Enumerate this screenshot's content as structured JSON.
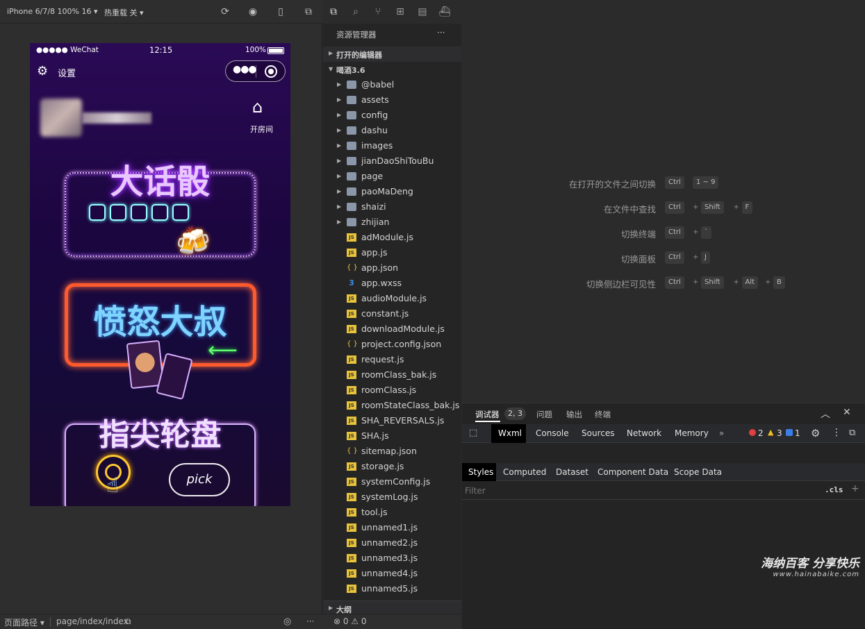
{
  "toolbar": {
    "device": "iPhone 6/7/8 100% 16",
    "hot_reload": "热重载 关"
  },
  "phone": {
    "carrier": "●●●●● WeChat",
    "time": "12:15",
    "battery": "100%",
    "settings": "设置",
    "open_room": "开房间",
    "games": [
      "大话骰",
      "愤怒大叔",
      "指尖轮盘"
    ],
    "pick": "pick"
  },
  "explorer": {
    "title": "资源管理器",
    "more": "···",
    "open_editors": "打开的编辑器",
    "project": "喝酒3.6",
    "outline": "大纲",
    "items": [
      {
        "label": "@babel",
        "type": "folder"
      },
      {
        "label": "assets",
        "type": "folder"
      },
      {
        "label": "config",
        "type": "folder"
      },
      {
        "label": "dashu",
        "type": "folder"
      },
      {
        "label": "images",
        "type": "folder"
      },
      {
        "label": "jianDaoShiTouBu",
        "type": "folder"
      },
      {
        "label": "page",
        "type": "folder"
      },
      {
        "label": "paoMaDeng",
        "type": "folder"
      },
      {
        "label": "shaizi",
        "type": "folder"
      },
      {
        "label": "zhijian",
        "type": "folder"
      },
      {
        "label": "adModule.js",
        "type": "js"
      },
      {
        "label": "app.js",
        "type": "js"
      },
      {
        "label": "app.json",
        "type": "json"
      },
      {
        "label": "app.wxss",
        "type": "css"
      },
      {
        "label": "audioModule.js",
        "type": "js"
      },
      {
        "label": "constant.js",
        "type": "js"
      },
      {
        "label": "downloadModule.js",
        "type": "js"
      },
      {
        "label": "project.config.json",
        "type": "json"
      },
      {
        "label": "request.js",
        "type": "js"
      },
      {
        "label": "roomClass_bak.js",
        "type": "js"
      },
      {
        "label": "roomClass.js",
        "type": "js"
      },
      {
        "label": "roomStateClass_bak.js",
        "type": "js"
      },
      {
        "label": "SHA_REVERSALS.js",
        "type": "js"
      },
      {
        "label": "SHA.js",
        "type": "js"
      },
      {
        "label": "sitemap.json",
        "type": "json"
      },
      {
        "label": "storage.js",
        "type": "js"
      },
      {
        "label": "systemConfig.js",
        "type": "js"
      },
      {
        "label": "systemLog.js",
        "type": "js"
      },
      {
        "label": "tool.js",
        "type": "js"
      },
      {
        "label": "unnamed1.js",
        "type": "js"
      },
      {
        "label": "unnamed2.js",
        "type": "js"
      },
      {
        "label": "unnamed3.js",
        "type": "js"
      },
      {
        "label": "unnamed4.js",
        "type": "js"
      },
      {
        "label": "unnamed5.js",
        "type": "js"
      }
    ]
  },
  "editor": {
    "hints": [
      {
        "label": "在打开的文件之间切换",
        "keys": [
          "Ctrl",
          "1 ~ 9"
        ],
        "sep": [
          ""
        ]
      },
      {
        "label": "在文件中查找",
        "keys": [
          "Ctrl",
          "Shift",
          "F"
        ],
        "sep": [
          "+",
          "+"
        ]
      },
      {
        "label": "切换终端",
        "keys": [
          "Ctrl",
          "`"
        ],
        "sep": [
          "+"
        ]
      },
      {
        "label": "切换面板",
        "keys": [
          "Ctrl",
          "J"
        ],
        "sep": [
          "+"
        ]
      },
      {
        "label": "切换侧边栏可见性",
        "keys": [
          "Ctrl",
          "Shift",
          "Alt",
          "B"
        ],
        "sep": [
          "+",
          "+",
          "+"
        ]
      }
    ]
  },
  "debugger": {
    "tabs": [
      "调试器",
      "问题",
      "输出",
      "终端"
    ],
    "badge": "2, 3",
    "devtools_tabs": [
      "Wxml",
      "Console",
      "Sources",
      "Network",
      "Memory"
    ],
    "more": "»",
    "errors": "2",
    "warnings": "3",
    "infos": "1",
    "style_tabs": [
      "Styles",
      "Computed",
      "Dataset",
      "Component Data",
      "Scope Data"
    ],
    "filter_placeholder": "Filter",
    "cls": ".cls",
    "add": "+"
  },
  "bottombar": {
    "path_label": "页面路径",
    "path": "page/index/index",
    "errors": "0",
    "warnings": "0"
  },
  "watermark": {
    "title": "海纳百客 分享快乐",
    "url": "www.hainabaike.com"
  }
}
